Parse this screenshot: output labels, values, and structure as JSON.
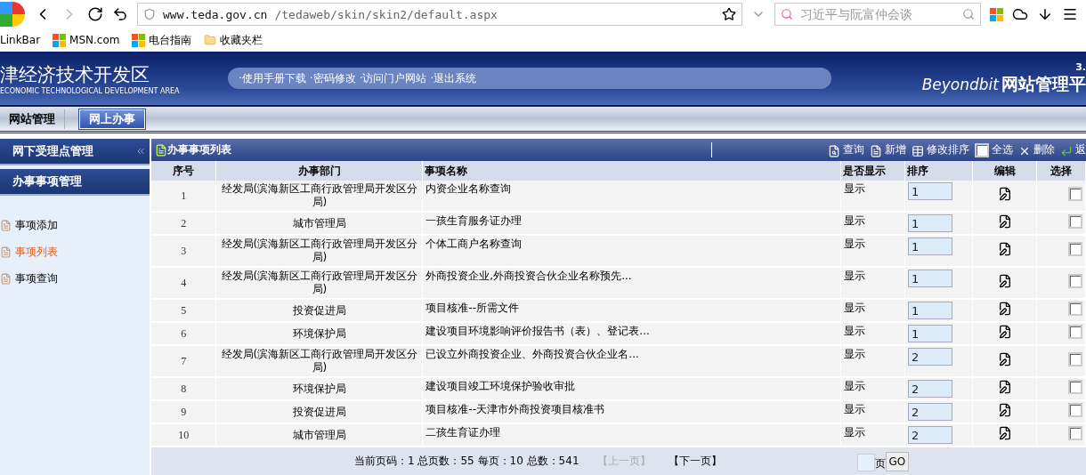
{
  "browser": {
    "address_host": "www.teda.gov.cn",
    "address_path": "/tedaweb/skin/skin2/default.aspx",
    "search_placeholder": "习近平与阮富仲会谈"
  },
  "bookmarks": [
    {
      "label": "LinkBar",
      "kind": "text"
    },
    {
      "label": "MSN.com",
      "kind": "tiles"
    },
    {
      "label": "电台指南",
      "kind": "tiles"
    },
    {
      "label": "收藏夹栏",
      "kind": "folder"
    }
  ],
  "header": {
    "logo_title": "津经济技术开发区",
    "logo_subtitle": "ECONOMIC TECHNOLOGICAL DEVELOPMENT AREA",
    "links": [
      "·使用手册下载",
      "·密码修改",
      "·访问门户网站",
      "·退出系统"
    ],
    "version": "3.",
    "brand": "Beyondbit",
    "platform_title": "网站管理平"
  },
  "nav_tabs": [
    {
      "label": "网站管理",
      "selected": false
    },
    {
      "label": "网上办事",
      "selected": true
    }
  ],
  "sidebar": {
    "sections": [
      "网下受理点管理",
      "办事事项管理"
    ],
    "items": [
      {
        "label": "事项添加",
        "selected": false
      },
      {
        "label": "事项列表",
        "selected": true
      },
      {
        "label": "事项查询",
        "selected": false
      }
    ]
  },
  "panel": {
    "title": "办事事项列表",
    "actions": [
      {
        "label": "查询",
        "kind": "search"
      },
      {
        "label": "新增",
        "kind": "add"
      },
      {
        "label": "修改排序",
        "kind": "sort"
      },
      {
        "label": "全选",
        "kind": "checkbox"
      },
      {
        "label": "删除",
        "kind": "delete"
      },
      {
        "label": "返",
        "kind": "back"
      }
    ]
  },
  "table": {
    "columns": [
      "序号",
      "办事部门",
      "事项名称",
      "是否显示",
      "排序",
      "编辑",
      "选择"
    ],
    "rows": [
      {
        "index": "1",
        "department": "经发局(滨海新区工商行政管理局开发区分局)",
        "name": "内资企业名称查询",
        "display": "显示",
        "order": "1",
        "checked": false
      },
      {
        "index": "2",
        "department": "城市管理局",
        "name": "一孩生育服务证办理",
        "display": "显示",
        "order": "1",
        "checked": false
      },
      {
        "index": "3",
        "department": "经发局(滨海新区工商行政管理局开发区分局)",
        "name": "个体工商户名称查询",
        "display": "显示",
        "order": "1",
        "checked": false
      },
      {
        "index": "4",
        "department": "经发局(滨海新区工商行政管理局开发区分局)",
        "name": "外商投资企业,外商投资合伙企业名称预先...",
        "display": "显示",
        "order": "1",
        "checked": false
      },
      {
        "index": "5",
        "department": "投资促进局",
        "name": "项目核准--所需文件",
        "display": "显示",
        "order": "1",
        "checked": false
      },
      {
        "index": "6",
        "department": "环境保护局",
        "name": "建设项目环境影响评价报告书（表）、登记表...",
        "display": "显示",
        "order": "1",
        "checked": false
      },
      {
        "index": "7",
        "department": "经发局(滨海新区工商行政管理局开发区分局)",
        "name": "已设立外商投资企业、外商投资合伙企业名...",
        "display": "显示",
        "order": "2",
        "checked": false
      },
      {
        "index": "8",
        "department": "环境保护局",
        "name": "建设项目竣工环境保护验收审批",
        "display": "显示",
        "order": "2",
        "checked": false
      },
      {
        "index": "9",
        "department": "投资促进局",
        "name": "项目核准--天津市外商投资项目核准书",
        "display": "显示",
        "order": "2",
        "checked": false
      },
      {
        "index": "10",
        "department": "城市管理局",
        "name": "二孩生育证办理",
        "display": "显示",
        "order": "2",
        "checked": false
      }
    ]
  },
  "pagination": {
    "info": "当前页码：1 总页数：55 每页：10 总数：541",
    "prev": {
      "label": "【上一页】",
      "disabled": true
    },
    "next": {
      "label": "【下一页】",
      "disabled": false
    },
    "page_label": "页",
    "go": "GO"
  }
}
